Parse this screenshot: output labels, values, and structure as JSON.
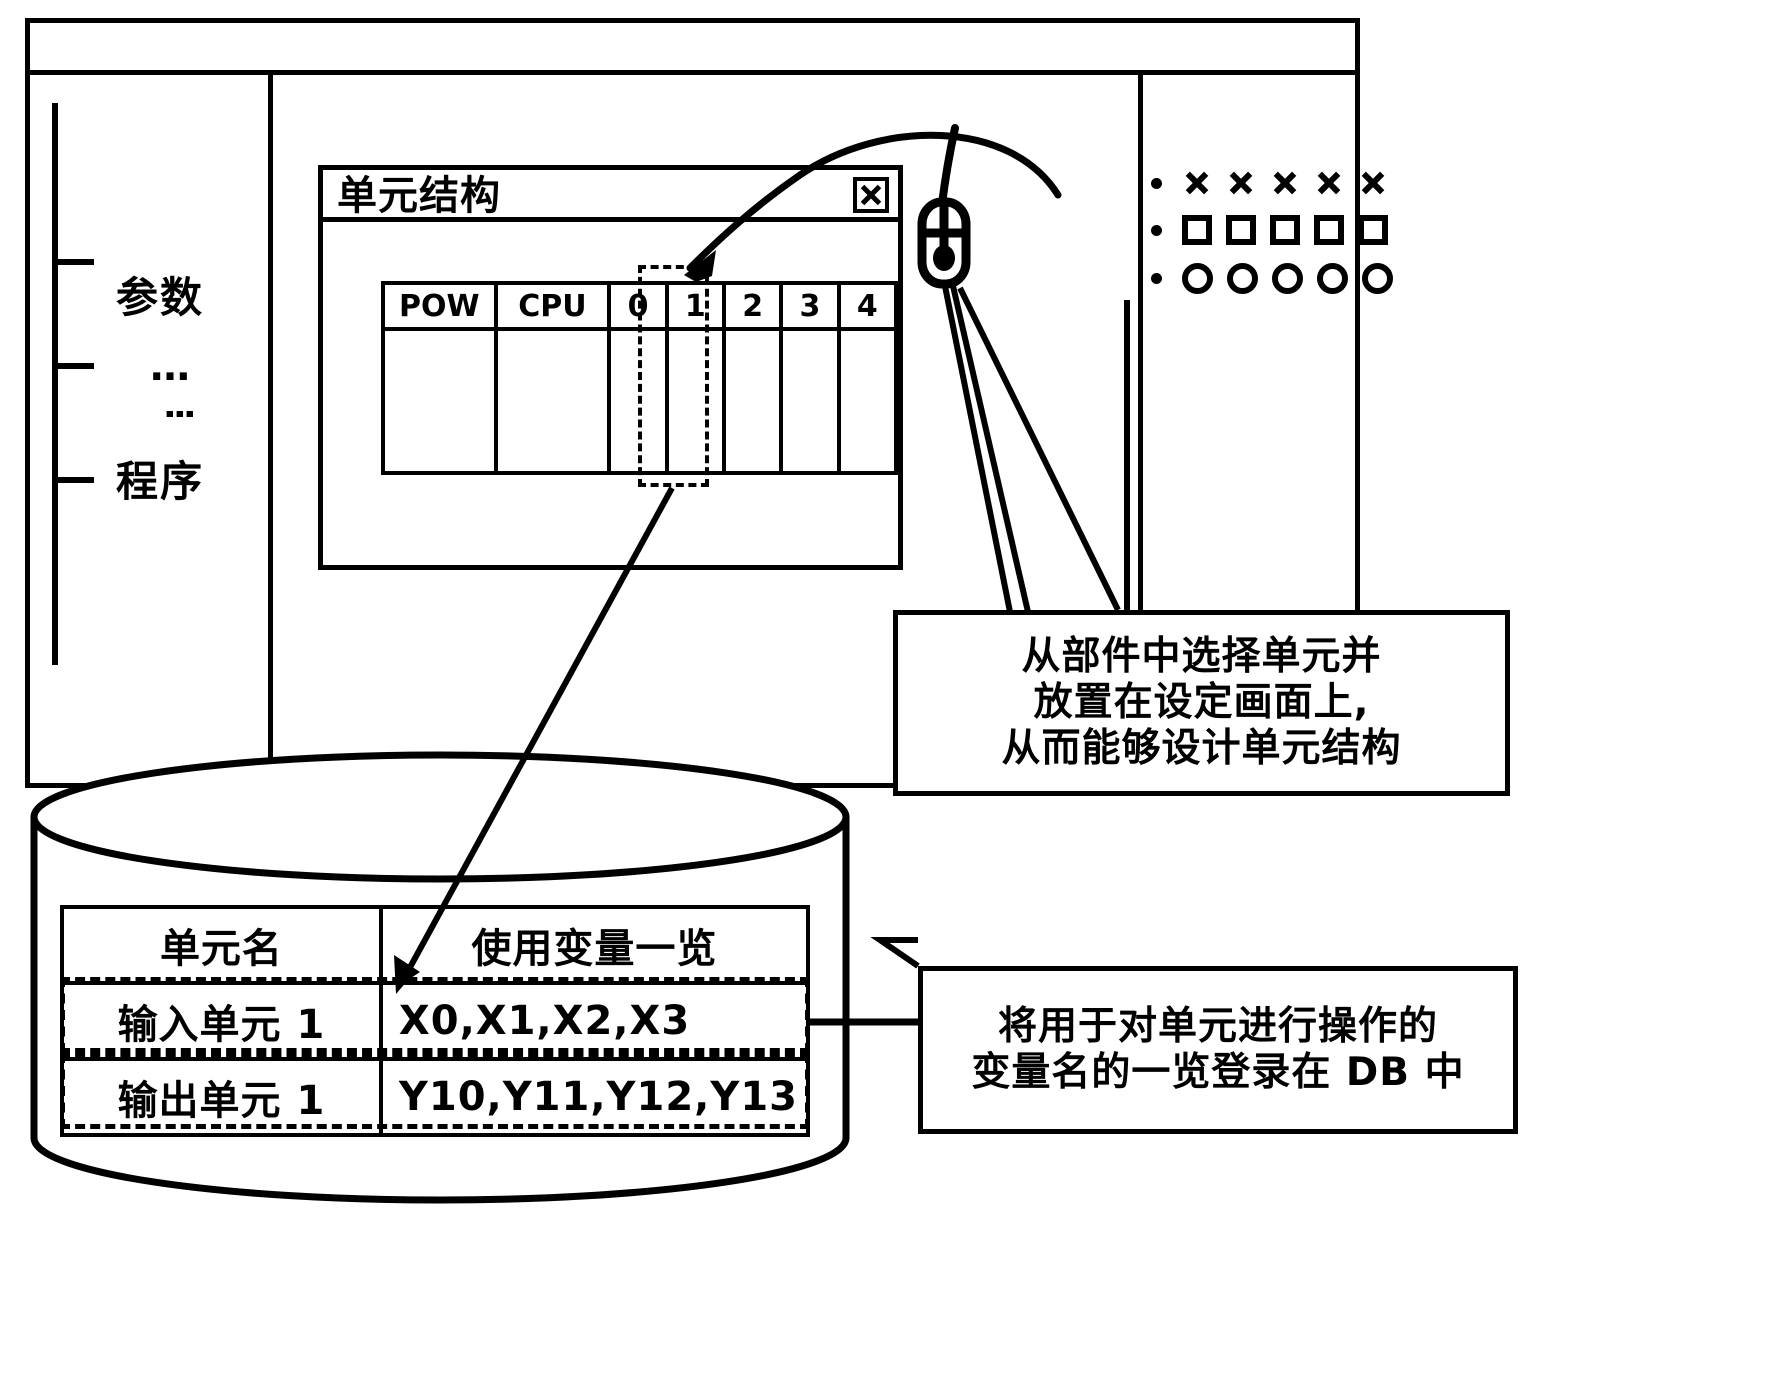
{
  "app_window": {
    "name": "configuration-tool-window",
    "tree": {
      "items": [
        {
          "label": "参数",
          "kind": "text"
        },
        {
          "label": "…",
          "kind": "ellipsis-horizontal"
        },
        {
          "label": "⋮",
          "kind": "ellipsis-vertical"
        },
        {
          "label": "程序",
          "kind": "text"
        }
      ]
    },
    "palette": {
      "rows": [
        {
          "bullet": "•",
          "icon": "x-mark-icon",
          "count": 5
        },
        {
          "bullet": "•",
          "icon": "square-icon",
          "count": 5
        },
        {
          "bullet": "•",
          "icon": "circle-icon",
          "count": 5
        }
      ]
    }
  },
  "dialog": {
    "title": "单元结构",
    "close_label": "×",
    "close_icon": "close-icon",
    "rack": {
      "slots": [
        "POW",
        "CPU",
        "0",
        "1",
        "2",
        "3",
        "4"
      ],
      "selected_slot": "1"
    }
  },
  "cursor": {
    "icon": "mouse-icon"
  },
  "callouts": {
    "palette_note": {
      "lines": [
        "从部件中选择单元并",
        "放置在设定画面上,",
        "从而能够设计单元结构"
      ]
    },
    "db_note": {
      "lines": [
        "将用于对单元进行操作的",
        "变量名的一览登录在 DB 中"
      ]
    }
  },
  "database": {
    "shape": "cylinder",
    "table": {
      "headers": [
        "单元名",
        "使用变量一览"
      ],
      "rows": [
        {
          "name": "输入单元 1",
          "vars": "X0,X1,X2,X3",
          "highlighted": true
        },
        {
          "name": "输出单元 1",
          "vars": "Y10,Y11,Y12,Y13",
          "highlighted": true
        }
      ]
    }
  },
  "colors": {
    "ink": "#000000",
    "paper": "#ffffff"
  }
}
